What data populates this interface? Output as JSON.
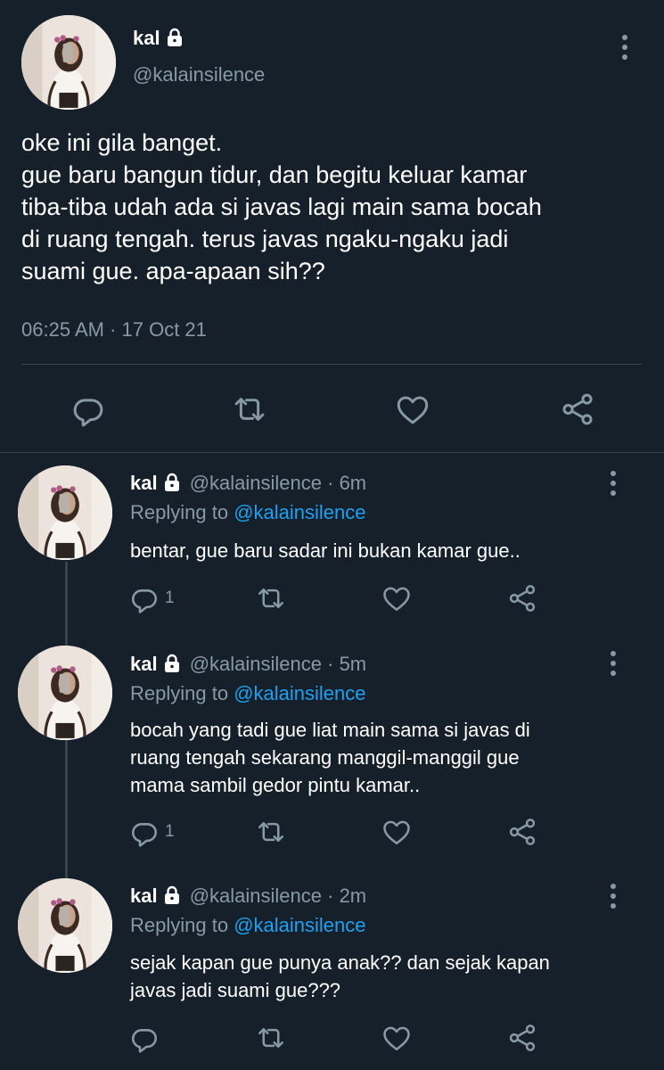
{
  "main_tweet": {
    "display_name": "kal",
    "handle": "@kalainsilence",
    "text_lines": [
      "oke ini gila banget.",
      "gue baru bangun tidur, dan begitu keluar kamar",
      "tiba-tiba udah ada si javas lagi main sama bocah",
      "di ruang tengah. terus javas ngaku-ngaku jadi",
      "suami gue. apa-apaan sih??"
    ],
    "timestamp": "06:25 AM · 17 Oct 21",
    "icons": [
      "reply-icon",
      "retweet-icon",
      "like-icon",
      "share-icon"
    ]
  },
  "replies": [
    {
      "display_name": "kal",
      "handle_time": "@kalainsilence · 6m",
      "replying_prefix": "Replying to",
      "replying_to": "@kalainsilence",
      "text_lines": [
        "bentar, gue baru sadar ini bukan kamar gue.."
      ],
      "reply_count": "1"
    },
    {
      "display_name": "kal",
      "handle_time": "@kalainsilence · 5m",
      "replying_prefix": "Replying to",
      "replying_to": "@kalainsilence",
      "text_lines": [
        "bocah yang tadi gue liat main sama si javas di",
        "ruang tengah sekarang manggil-manggil gue",
        "mama sambil gedor pintu kamar.."
      ],
      "reply_count": "1"
    },
    {
      "display_name": "kal",
      "handle_time": "@kalainsilence · 2m",
      "replying_prefix": "Replying to",
      "replying_to": "@kalainsilence",
      "text_lines": [
        "sejak kapan gue punya anak?? dan sejak kapan",
        "javas jadi suami gue???"
      ],
      "reply_count": ""
    }
  ],
  "colors": {
    "background": "#15202b",
    "muted": "#8899a6",
    "link": "#1da1f2",
    "divider": "#38444d"
  }
}
